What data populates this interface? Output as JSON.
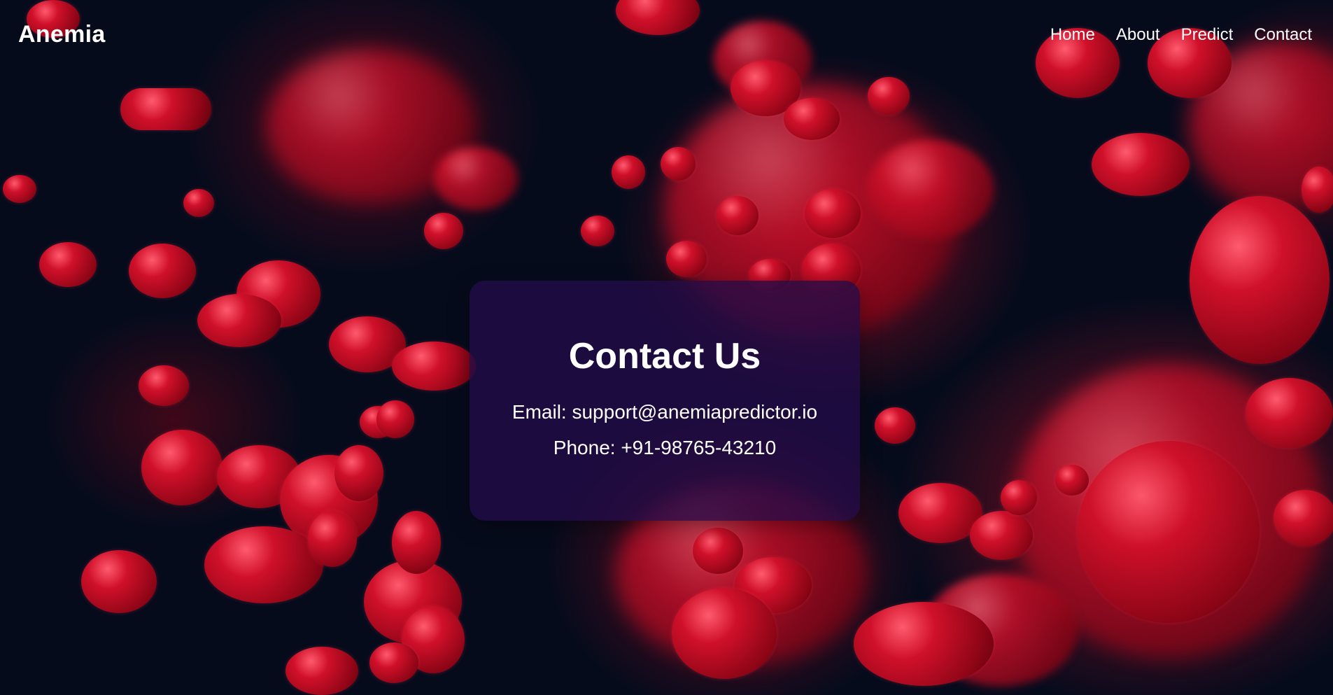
{
  "navbar": {
    "brand": "Anemia",
    "links": [
      "Home",
      "About",
      "Predict",
      "Contact"
    ]
  },
  "contact": {
    "title": "Contact Us",
    "email_line": "Email: support@anemiapredictor.io",
    "phone_line": "Phone: +91-98765-43210"
  },
  "colors": {
    "background": "#060b1c",
    "card": "#220c48",
    "text": "#ffffff",
    "blood_red": "#d0102a"
  }
}
